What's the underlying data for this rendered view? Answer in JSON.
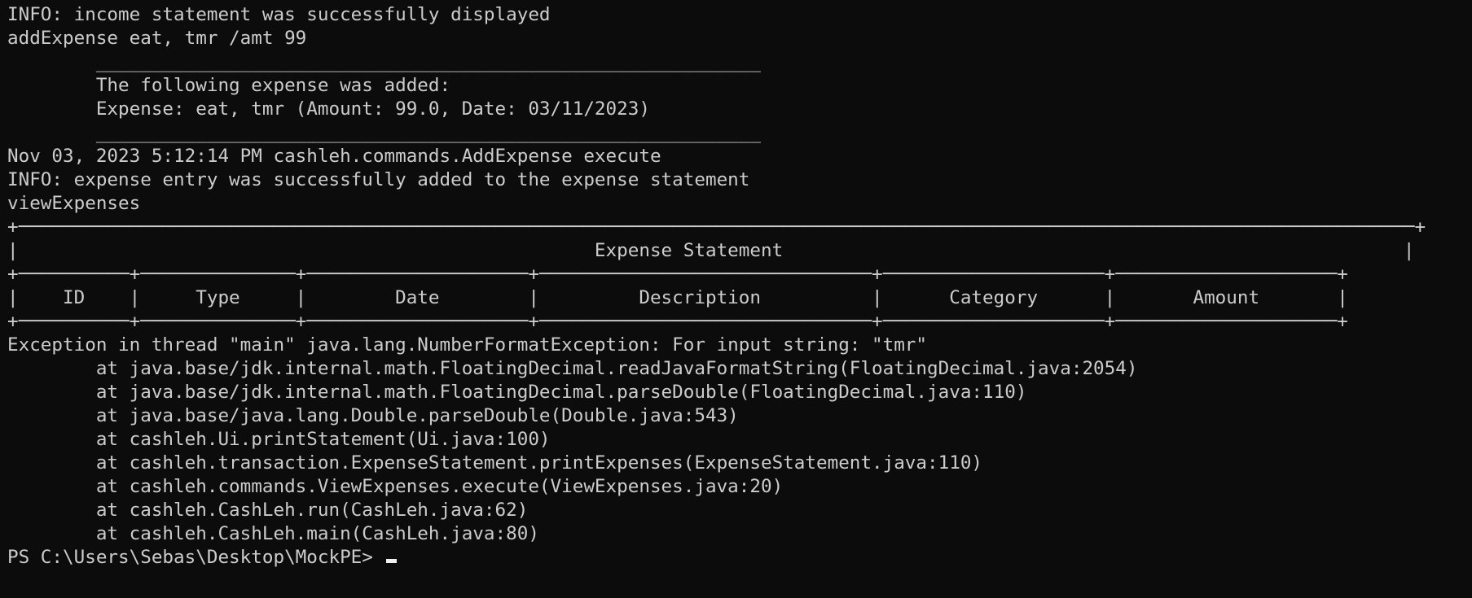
{
  "terminal": {
    "lines": [
      "INFO: income statement was successfully displayed",
      "addExpense eat, tmr /amt 99",
      "        ____________________________________________________________",
      "        The following expense was added:",
      "        Expense: eat, tmr (Amount: 99.0, Date: 03/11/2023)",
      "        ____________________________________________________________",
      "Nov 03, 2023 5:12:14 PM cashleh.commands.AddExpense execute",
      "INFO: expense entry was successfully added to the expense statement",
      "viewExpenses",
      "+──────────────────────────────────────────────────────────────────────────────────────────────────────────────────────────────+",
      "|                                                    Expense Statement                                                        |",
      "+──────────+──────────────+────────────────────+──────────────────────────────+────────────────────+────────────────────+",
      "|    ID    |     Type     |        Date        |         Description          |      Category      |       Amount       |",
      "+──────────+──────────────+────────────────────+──────────────────────────────+────────────────────+────────────────────+",
      "Exception in thread \"main\" java.lang.NumberFormatException: For input string: \"tmr\"",
      "        at java.base/jdk.internal.math.FloatingDecimal.readJavaFormatString(FloatingDecimal.java:2054)",
      "        at java.base/jdk.internal.math.FloatingDecimal.parseDouble(FloatingDecimal.java:110)",
      "        at java.base/java.lang.Double.parseDouble(Double.java:543)",
      "        at cashleh.Ui.printStatement(Ui.java:100)",
      "        at cashleh.transaction.ExpenseStatement.printExpenses(ExpenseStatement.java:110)",
      "        at cashleh.commands.ViewExpenses.execute(ViewExpenses.java:20)",
      "        at cashleh.CashLeh.run(CashLeh.java:62)",
      "        at cashleh.CashLeh.main(CashLeh.java:80)"
    ],
    "prompt": "PS C:\\Users\\Sebas\\Desktop\\MockPE> "
  }
}
